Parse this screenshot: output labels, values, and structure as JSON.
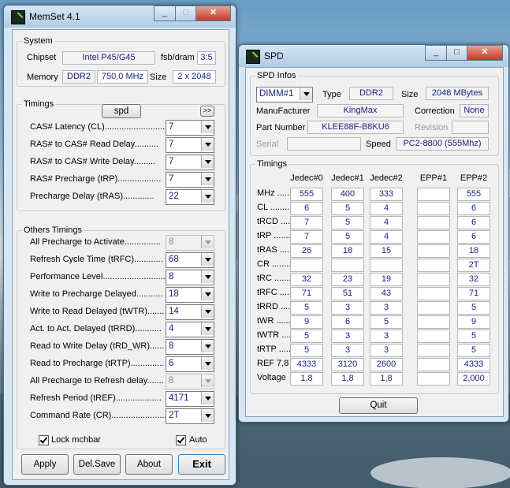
{
  "memset": {
    "title": "MemSet 4.1",
    "system": {
      "legend": "System",
      "chipset_label": "Chipset",
      "chipset_value": "Intel P45/G45",
      "fsb_label": "fsb/dram",
      "fsb_value": "3:5",
      "memory_label": "Memory",
      "mem_type": "DDR2",
      "mem_speed": "750,0 MHz",
      "size_label": "Size",
      "size_value": "2 x 2048"
    },
    "timings": {
      "legend": "Timings",
      "spd_button": "spd",
      "expand_button": ">>",
      "rows": [
        {
          "label": "CAS# Latency (CL)..........................",
          "value": "7"
        },
        {
          "label": "RAS# to CAS# Read Delay..........",
          "value": "7"
        },
        {
          "label": "RAS# to CAS# Write Delay.........",
          "value": "7"
        },
        {
          "label": "RAS# Precharge (tRP)..................",
          "value": "7"
        },
        {
          "label": "Precharge Delay  (tRAS).............",
          "value": "22"
        }
      ]
    },
    "others": {
      "legend": "Others Timings",
      "rows": [
        {
          "label": "All Precharge to Activate...............",
          "value": "8",
          "disabled": true
        },
        {
          "label": "Refresh Cycle Time (tRFC)............",
          "value": "68",
          "disabled": false
        },
        {
          "label": "Performance Level...........................",
          "value": "8",
          "disabled": false
        },
        {
          "label": "Write to Precharge Delayed...........",
          "value": "18",
          "disabled": false
        },
        {
          "label": "Write to Read Delayed (tWTR).......",
          "value": "14",
          "disabled": false
        },
        {
          "label": "Act. to Act. Delayed (tRRD)...........",
          "value": "4",
          "disabled": false
        },
        {
          "label": "Read to Write Delay (tRD_WR)......",
          "value": "8",
          "disabled": false
        },
        {
          "label": "Read to Precharge (tRTP)..............",
          "value": "6",
          "disabled": false
        },
        {
          "label": "All Precharge to Refresh delay.......",
          "value": "8",
          "disabled": true
        },
        {
          "label": "Refresh Period (tREF)...................",
          "value": "4171",
          "disabled": false
        },
        {
          "label": "Command Rate (CR)........................",
          "value": "2T",
          "disabled": false
        }
      ],
      "lock_label": "Lock mchbar",
      "auto_label": "Auto"
    },
    "buttons": {
      "apply": "Apply",
      "delsave": "Del.Save",
      "about": "About",
      "exit": "Exit"
    }
  },
  "spd": {
    "title": "SPD",
    "infos": {
      "legend": "SPD Infos",
      "dimm_value": "DIMM#1",
      "type_label": "Type",
      "type_value": "DDR2",
      "size_label": "Size",
      "size_value": "2048 MBytes",
      "manufacturer_label": "ManuFacturer",
      "manufacturer_value": "KingMax",
      "correction_label": "Correction",
      "correction_value": "None",
      "part_label": "Part Number",
      "part_value": "KLEE88F-B8KU6",
      "revision_label": "Revision",
      "revision_value": "",
      "serial_label": "Serial",
      "serial_value": "",
      "speed_label": "Speed",
      "speed_value": "PC2-8800 (555Mhz)"
    },
    "timings": {
      "legend": "Timings",
      "headers": [
        "Jedec#0",
        "Jedec#1",
        "Jedec#2",
        "EPP#1",
        "EPP#2"
      ],
      "rows": [
        {
          "label": "MHz .......",
          "values": [
            "555",
            "400",
            "333",
            "",
            "555"
          ]
        },
        {
          "label": "CL .........",
          "values": [
            "6",
            "5",
            "4",
            "",
            "6"
          ]
        },
        {
          "label": "tRCD .......",
          "values": [
            "7",
            "5",
            "4",
            "",
            "6"
          ]
        },
        {
          "label": "tRP .........",
          "values": [
            "7",
            "5",
            "4",
            "",
            "6"
          ]
        },
        {
          "label": "tRAS ......",
          "values": [
            "26",
            "18",
            "15",
            "",
            "18"
          ]
        },
        {
          "label": "CR ..........",
          "values": [
            "",
            "",
            "",
            "",
            "2T"
          ]
        },
        {
          "label": "tRC .........",
          "values": [
            "32",
            "23",
            "19",
            "",
            "32"
          ]
        },
        {
          "label": "tRFC .......",
          "values": [
            "71",
            "51",
            "43",
            "",
            "71"
          ]
        },
        {
          "label": "tRRD .......",
          "values": [
            "5",
            "3",
            "3",
            "",
            "5"
          ]
        },
        {
          "label": "tWR .........",
          "values": [
            "9",
            "6",
            "5",
            "",
            "9"
          ]
        },
        {
          "label": "tWTR .......",
          "values": [
            "5",
            "3",
            "3",
            "",
            "5"
          ]
        },
        {
          "label": "tRTP .......",
          "values": [
            "5",
            "3",
            "3",
            "",
            "5"
          ]
        },
        {
          "label": "REF 7,8",
          "values": [
            "4333",
            "3120",
            "2600",
            "",
            "4333"
          ]
        },
        {
          "label": "Voltage",
          "values": [
            "1,8",
            "1,8",
            "1,8",
            "",
            "2,000"
          ]
        }
      ]
    },
    "quit_button": "Quit"
  }
}
